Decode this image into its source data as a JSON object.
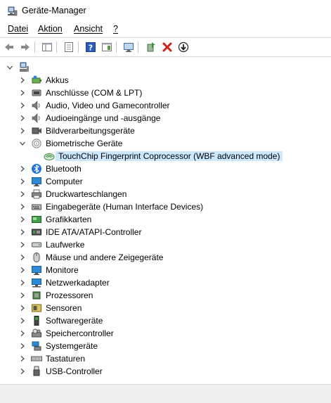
{
  "window": {
    "title": "Geräte-Manager"
  },
  "menu": {
    "items": [
      "Datei",
      "Aktion",
      "Ansicht",
      "?"
    ]
  },
  "tree": {
    "root_icon": "computer-icon",
    "items": [
      {
        "label": "Akkus",
        "icon": "battery-icon",
        "state": "collapsed"
      },
      {
        "label": "Anschlüsse (COM & LPT)",
        "icon": "port-icon",
        "state": "collapsed"
      },
      {
        "label": "Audio, Video und Gamecontroller",
        "icon": "speaker-icon",
        "state": "collapsed"
      },
      {
        "label": "Audioeingänge und -ausgänge",
        "icon": "speaker-icon",
        "state": "collapsed"
      },
      {
        "label": "Bildverarbeitungsgeräte",
        "icon": "camera-icon",
        "state": "collapsed"
      },
      {
        "label": "Biometrische Geräte",
        "icon": "fingerprint-icon",
        "state": "expanded"
      },
      {
        "label": "TouchChip Fingerprint Coprocessor (WBF advanced mode)",
        "icon": "fingerprint-device-icon",
        "state": "child",
        "selected": true
      },
      {
        "label": "Bluetooth",
        "icon": "bluetooth-icon",
        "state": "collapsed"
      },
      {
        "label": "Computer",
        "icon": "monitor-icon",
        "state": "collapsed"
      },
      {
        "label": "Druckwarteschlangen",
        "icon": "printer-icon",
        "state": "collapsed"
      },
      {
        "label": "Eingabegeräte (Human Interface Devices)",
        "icon": "hid-icon",
        "state": "collapsed"
      },
      {
        "label": "Grafikkarten",
        "icon": "display-adapter-icon",
        "state": "collapsed"
      },
      {
        "label": "IDE ATA/ATAPI-Controller",
        "icon": "ide-controller-icon",
        "state": "collapsed"
      },
      {
        "label": "Laufwerke",
        "icon": "disk-drive-icon",
        "state": "collapsed"
      },
      {
        "label": "Mäuse und andere Zeigegeräte",
        "icon": "mouse-icon",
        "state": "collapsed"
      },
      {
        "label": "Monitore",
        "icon": "monitor-icon",
        "state": "collapsed"
      },
      {
        "label": "Netzwerkadapter",
        "icon": "network-icon",
        "state": "collapsed"
      },
      {
        "label": "Prozessoren",
        "icon": "processor-icon",
        "state": "collapsed"
      },
      {
        "label": "Sensoren",
        "icon": "sensor-icon",
        "state": "collapsed"
      },
      {
        "label": "Softwaregeräte",
        "icon": "software-device-icon",
        "state": "collapsed"
      },
      {
        "label": "Speichercontroller",
        "icon": "storage-controller-icon",
        "state": "collapsed"
      },
      {
        "label": "Systemgeräte",
        "icon": "system-device-icon",
        "state": "collapsed"
      },
      {
        "label": "Tastaturen",
        "icon": "keyboard-icon",
        "state": "collapsed"
      },
      {
        "label": "USB-Controller",
        "icon": "usb-icon",
        "state": "collapsed"
      }
    ]
  },
  "colors": {
    "selection": "#cce8ff",
    "chevron": "#444444",
    "remove_red": "#d21f1f",
    "help_blue": "#2b5cb8"
  }
}
